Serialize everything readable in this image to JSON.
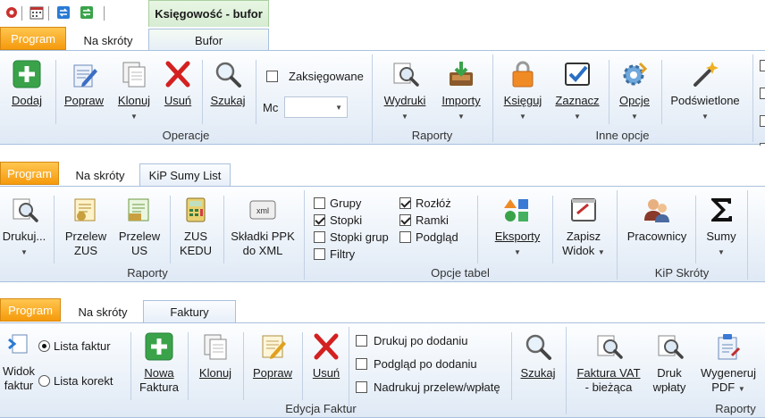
{
  "panel1": {
    "context_tab": "Księgowość - bufor",
    "tabs": [
      "Program",
      "Na skróty",
      "Bufor"
    ],
    "buttons": {
      "dodaj": "Dodaj",
      "popraw": "Popraw",
      "klonuj": "Klonuj",
      "usun": "Usuń",
      "szukaj": "Szukaj",
      "wydruki": "Wydruki",
      "importy": "Importy",
      "ksieguj": "Księguj",
      "zaznacz": "Zaznacz",
      "opcje": "Opcje",
      "podswietlone": "Podświetlone"
    },
    "zaksiegowane": "Zaksięgowane",
    "mc_label": "Mc",
    "mc_value": "",
    "groups": [
      "Operacje",
      "Raporty",
      "Inne opcje"
    ]
  },
  "panel2": {
    "tabs": [
      "Program",
      "Na skróty",
      "KiP Sumy List"
    ],
    "buttons": {
      "drukuj": "Drukuj...",
      "przelew_zus_1": "Przelew",
      "przelew_zus_2": "ZUS",
      "przelew_us_1": "Przelew",
      "przelew_us_2": "US",
      "zus_kedu_1": "ZUS",
      "zus_kedu_2": "KEDU",
      "skladki_1": "Składki PPK",
      "skladki_2": "do XML",
      "eksporty": "Eksporty",
      "zapisz_1": "Zapisz",
      "zapisz_2": "Widok",
      "pracownicy": "Pracownicy",
      "sumy": "Sumy"
    },
    "checks": {
      "grupy": "Grupy",
      "stopki": "Stopki",
      "stopki_grup": "Stopki grup",
      "filtry": "Filtry",
      "rozloz": "Rozłóż",
      "ramki": "Ramki",
      "podglad": "Podgląd"
    },
    "groups": [
      "Raporty",
      "Opcje tabel",
      "KiP Skróty"
    ]
  },
  "panel3": {
    "tabs": [
      "Program",
      "Na skróty",
      "Faktury"
    ],
    "widok_1": "Widok",
    "widok_2": "faktur",
    "radio_lista_faktur": "Lista faktur",
    "radio_lista_korekt": "Lista korekt",
    "buttons": {
      "nowa_1": "Nowa",
      "nowa_2": "Faktura",
      "klonuj": "Klonuj",
      "popraw": "Popraw",
      "usun": "Usuń",
      "szukaj": "Szukaj",
      "faktura_vat_1": "Faktura VAT",
      "faktura_vat_2": "- bieżąca",
      "druk_1": "Druk",
      "druk_2": "wpłaty",
      "wygeneruj_1": "Wygeneruj",
      "wygeneruj_2": "PDF"
    },
    "checks": {
      "drukuj_po": "Drukuj po dodaniu",
      "podglad_po": "Podgląd po dodaniu",
      "nadrukuj": "Nadrukuj przelew/wpłatę"
    },
    "groups": [
      "Edycja Faktur",
      "Raporty"
    ]
  },
  "colors": {
    "program_tab": "#f59a0c",
    "context_tab": "#d6ecd2",
    "ribbon_border": "#a9c0de"
  }
}
